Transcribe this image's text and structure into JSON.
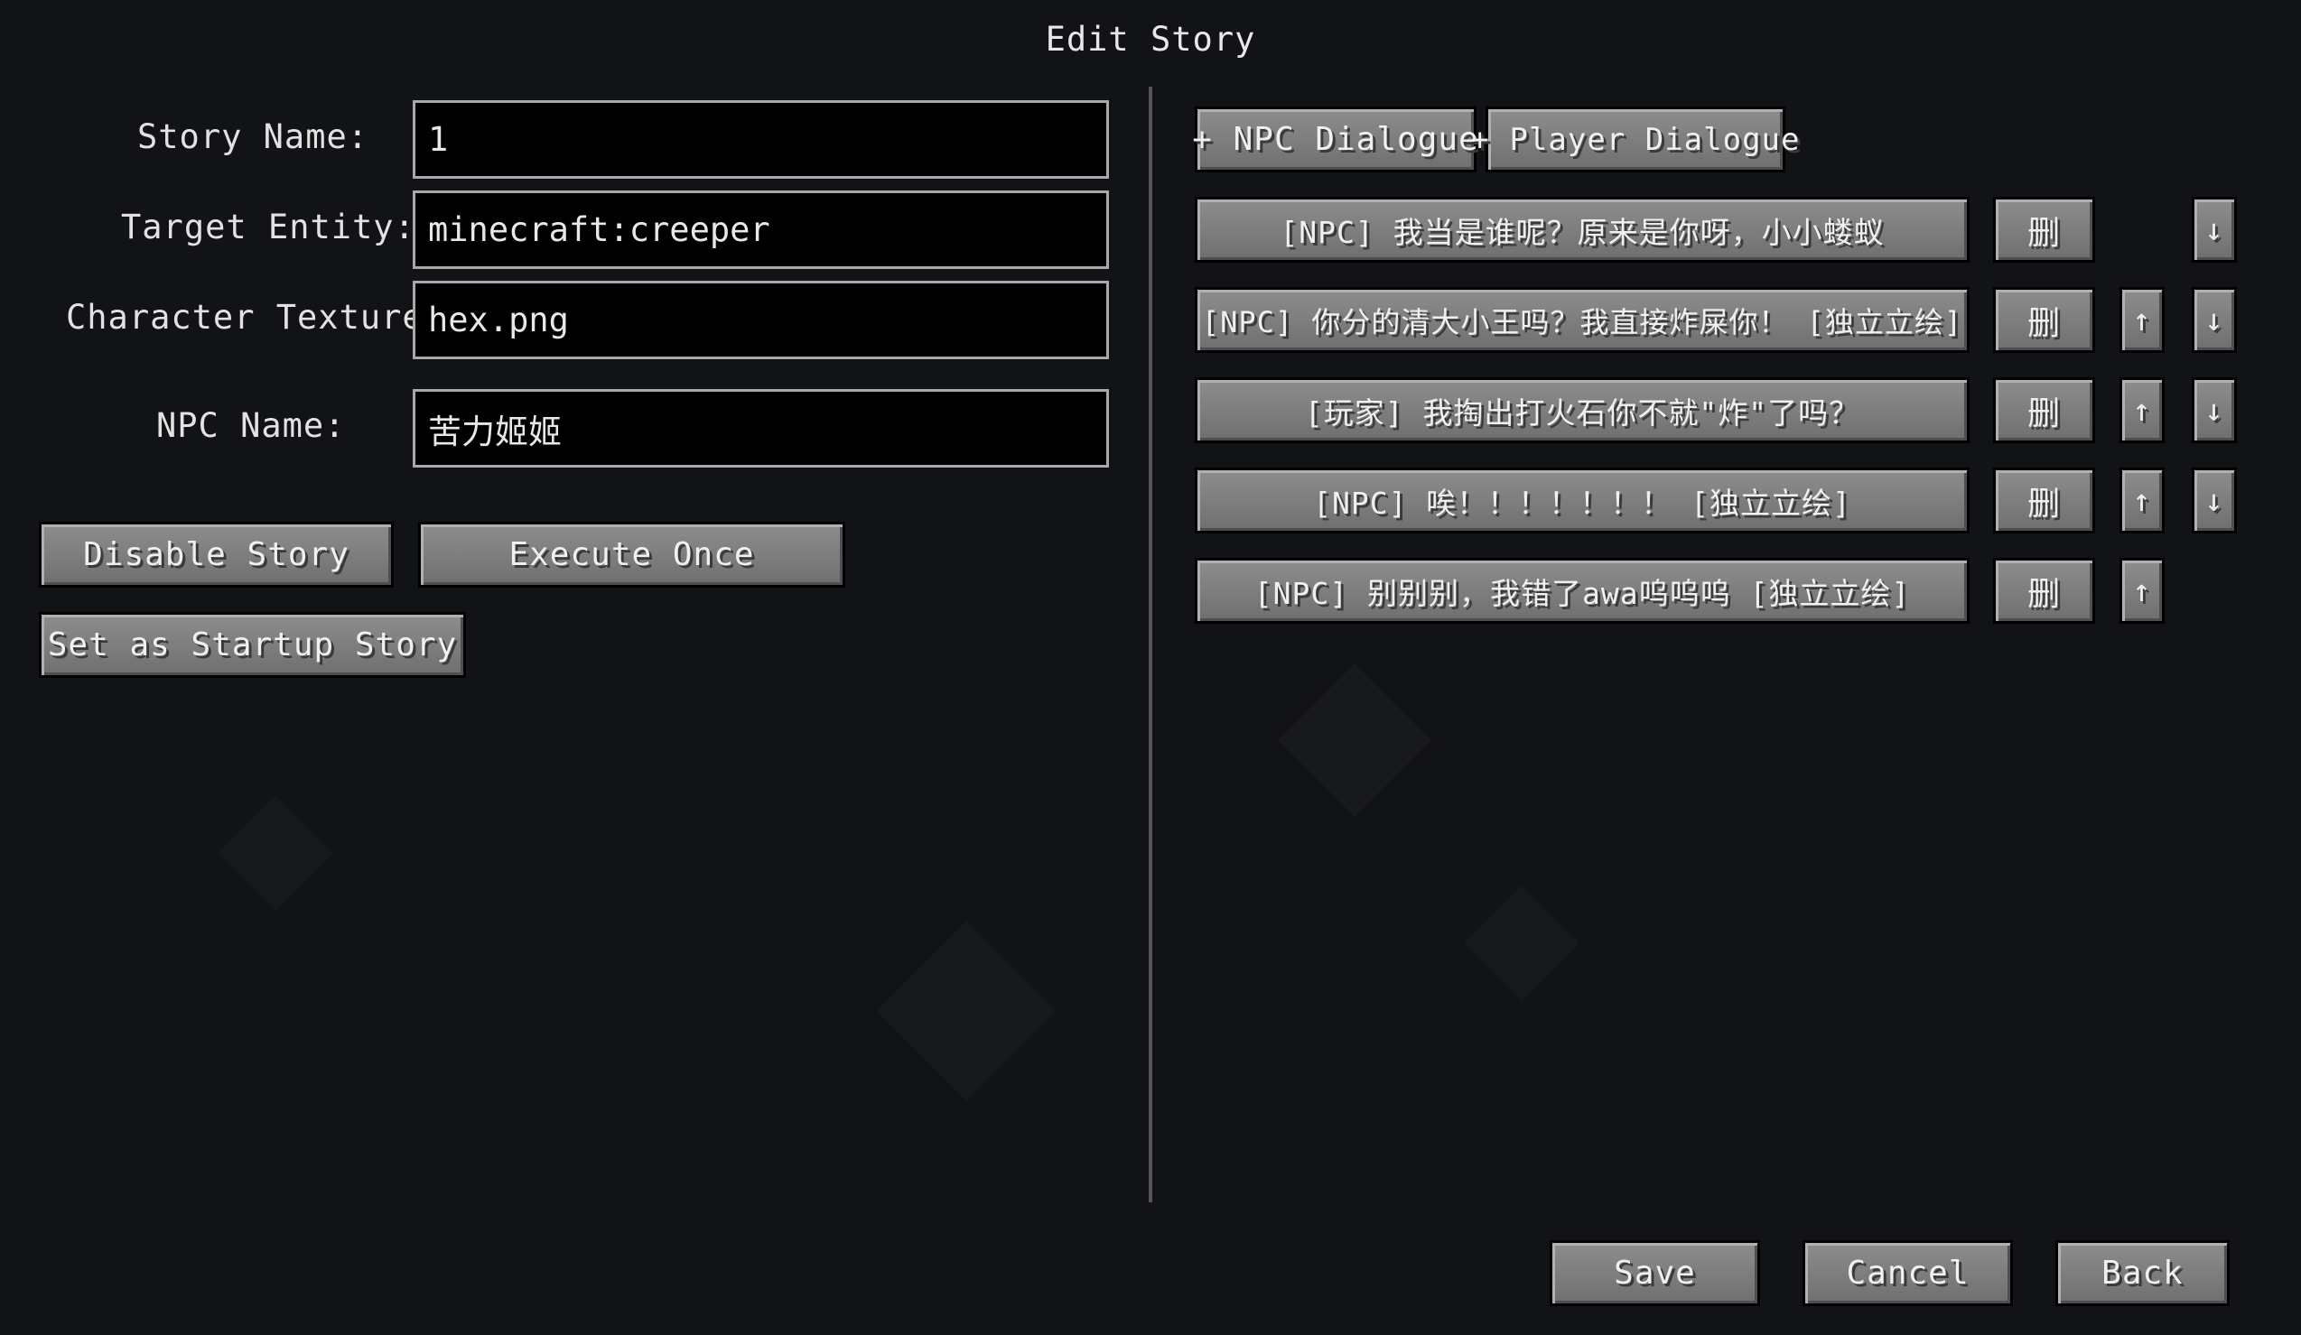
{
  "title": "Edit Story",
  "form": {
    "story_name_label": "Story Name:",
    "story_name_value": "1",
    "target_entity_label": "Target Entity:",
    "target_entity_value": "minecraft:creeper",
    "character_texture_label": "Character Texture",
    "character_texture_value": "hex.png",
    "npc_name_label": "NPC Name:",
    "npc_name_value": "苦力姬姬"
  },
  "buttons": {
    "disable_story": "Disable Story",
    "execute_once": "Execute Once",
    "set_startup": "Set as Startup Story",
    "add_npc_dialogue": "+ NPC Dialogue",
    "add_player_dialogue": "+ Player Dialogue",
    "save": "Save",
    "cancel": "Cancel",
    "back": "Back"
  },
  "dialogues": [
    {
      "text": "[NPC] 我当是谁呢？原来是你呀，小小蝼蚁",
      "delete": "删",
      "up": "",
      "down": "↓"
    },
    {
      "text": "[NPC] 你分的清大小王吗？我直接炸屎你！ [独立立绘]",
      "delete": "删",
      "up": "↑",
      "down": "↓"
    },
    {
      "text": "[玩家] 我掏出打火石你不就\"炸\"了吗？",
      "delete": "删",
      "up": "↑",
      "down": "↓"
    },
    {
      "text": "[NPC] 唉！！！！！！！ [独立立绘]",
      "delete": "删",
      "up": "↑",
      "down": "↓"
    },
    {
      "text": "[NPC] 别别别，我错了awa呜呜呜 [独立立绘]",
      "delete": "删",
      "up": "↑",
      "down": ""
    }
  ]
}
